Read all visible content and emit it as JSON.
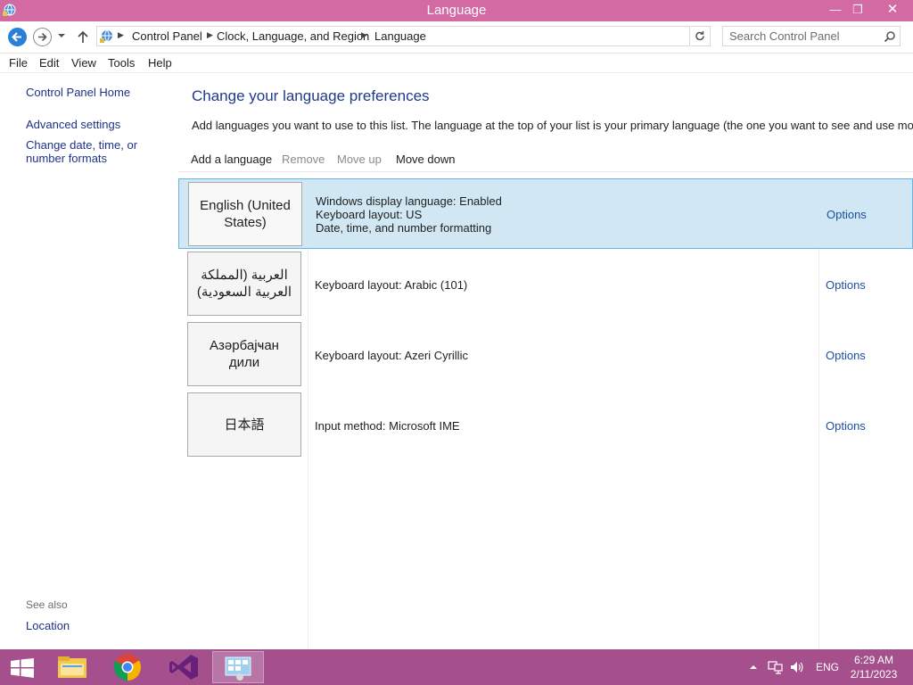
{
  "window": {
    "title": "Language",
    "minimize_glyph": "—",
    "maximize_glyph": "❐",
    "close_glyph": "✕"
  },
  "address": {
    "crumbs": [
      "Control Panel",
      "Clock, Language, and Region",
      "Language"
    ],
    "search_placeholder": "Search Control Panel"
  },
  "menu": {
    "items": [
      "File",
      "Edit",
      "View",
      "Tools",
      "Help"
    ]
  },
  "sidebar": {
    "links": [
      "Control Panel Home",
      "Advanced settings",
      "Change date, time, or number formats"
    ],
    "see_also_label": "See also",
    "see_also_links": [
      "Location"
    ]
  },
  "main": {
    "heading": "Change your language preferences",
    "description": "Add languages you want to use to this list. The language at the top of your list is your primary language (the one you want to see and use most often).",
    "toolbar": {
      "add": "Add a language",
      "remove": "Remove",
      "move_up": "Move up",
      "move_down": "Move down"
    },
    "languages": [
      {
        "name": "English (United States)",
        "details": [
          "Windows display language: Enabled",
          "Keyboard layout: US",
          "Date, time, and number formatting"
        ],
        "options": "Options",
        "selected": true
      },
      {
        "name": "العربية (المملكة العربية السعودية)",
        "details": [
          "Keyboard layout: Arabic (101)"
        ],
        "options": "Options",
        "selected": false
      },
      {
        "name": "Азәрбајҹан дили",
        "details": [
          "Keyboard layout: Azeri Cyrillic"
        ],
        "options": "Options",
        "selected": false
      },
      {
        "name": "日本語",
        "details": [
          "Input method: Microsoft IME"
        ],
        "options": "Options",
        "selected": false
      }
    ]
  },
  "taskbar": {
    "apps": [
      "file-explorer-icon",
      "chrome-icon",
      "visual-studio-icon",
      "control-panel-icon"
    ],
    "language_indicator": "ENG",
    "time": "6:29 AM",
    "date": "2/11/2023"
  },
  "colors": {
    "titlebar": "#d36aa4",
    "taskbar": "#a5508d",
    "selected_row": "#d1e8f4",
    "link": "#1e3287",
    "heading": "#1e3a8a"
  }
}
